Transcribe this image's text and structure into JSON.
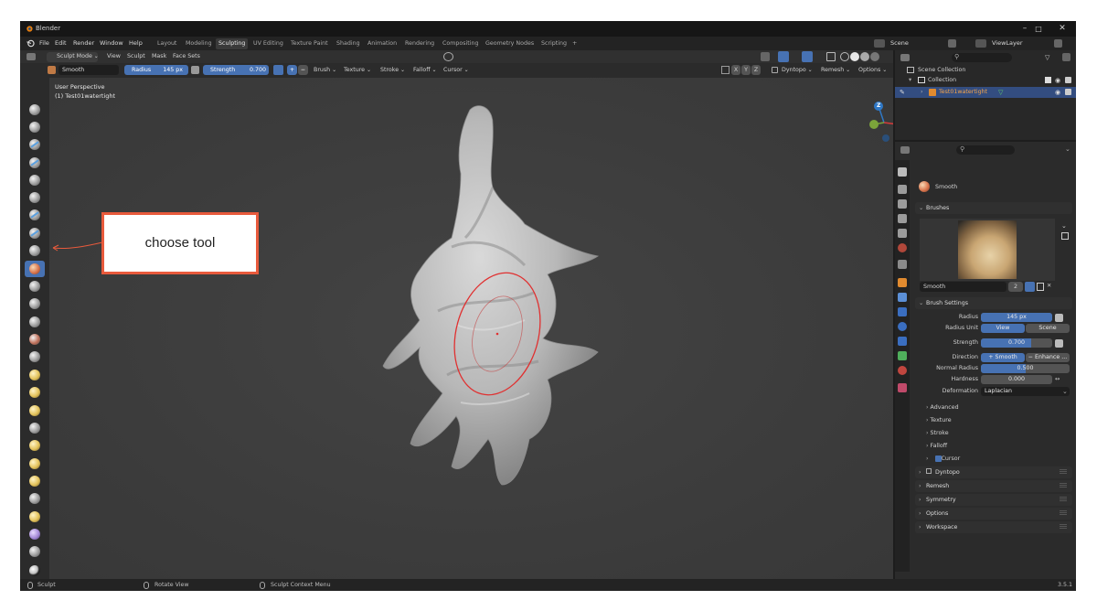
{
  "window": {
    "title": "Blender",
    "controls": [
      "–",
      "□",
      "✕"
    ]
  },
  "menubar": {
    "menus": [
      "File",
      "Edit",
      "Render",
      "Window",
      "Help"
    ],
    "workspaces": [
      "Layout",
      "Modeling",
      "Sculpting",
      "UV Editing",
      "Texture Paint",
      "Shading",
      "Animation",
      "Rendering",
      "Compositing",
      "Geometry Nodes",
      "Scripting",
      "+"
    ],
    "active_workspace": "Sculpting",
    "scene": "Scene",
    "view_layer": "ViewLayer"
  },
  "header": {
    "mode": "Sculpt Mode",
    "menus": [
      "View",
      "Sculpt",
      "Mask",
      "Face Sets"
    ],
    "axes": [
      "X",
      "Y",
      "Z"
    ],
    "right_menus": [
      "Dyntopo",
      "Remesh",
      "Options"
    ]
  },
  "tool_settings": {
    "brush_name": "Smooth",
    "radius_label": "Radius",
    "radius_value": "145 px",
    "strength_label": "Strength",
    "strength_value": "0.700",
    "plus": "+",
    "minus": "−",
    "menus": [
      "Brush",
      "Texture",
      "Stroke",
      "Falloff",
      "Cursor"
    ]
  },
  "viewport": {
    "perspective": "User Perspective",
    "object": "(1) Test01watertight",
    "gizmo_z": "Z",
    "gizmo_y": "Y",
    "gizmo_x": "X"
  },
  "outliner": {
    "scene_collection": "Scene Collection",
    "collection": "Collection",
    "object": "Test01watertight"
  },
  "properties": {
    "active_tool": "Smooth",
    "brushes_panel": "Brushes",
    "brush_name": "Smooth",
    "brush_users": "2",
    "brush_settings_panel": "Brush Settings",
    "rows": [
      {
        "label": "Radius",
        "value": "145 px",
        "fill": 1.0
      },
      {
        "label": "Strength",
        "value": "0.700",
        "fill": 0.7
      },
      {
        "label": "Normal Radius",
        "value": "0.500",
        "fill": 0.5
      },
      {
        "label": "Hardness",
        "value": "0.000",
        "fill": 0.0
      }
    ],
    "radius_unit_label": "Radius Unit",
    "radius_unit_options": [
      "View",
      "Scene"
    ],
    "direction_label": "Direction",
    "direction_options": [
      "+ Smooth",
      "− Enhance ..."
    ],
    "deformation_label": "Deformation",
    "deformation_value": "Laplacian",
    "subpanels": [
      "Advanced",
      "Texture",
      "Stroke",
      "Falloff",
      "Cursor"
    ],
    "panels": [
      "Dyntopo",
      "Remesh",
      "Symmetry",
      "Options",
      "Workspace"
    ]
  },
  "statusbar": {
    "left": "Sculpt",
    "middle": "Rotate View",
    "right": "Sculpt Context Menu",
    "version": "3.5.1"
  },
  "annotation": {
    "text": "choose tool",
    "color": "#e85a3c"
  }
}
